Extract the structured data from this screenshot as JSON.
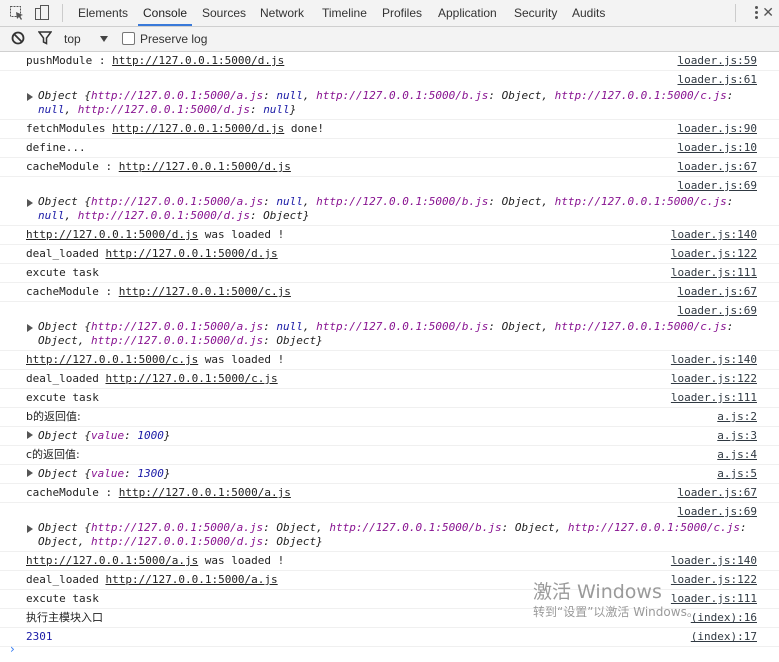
{
  "tabs": [
    "Elements",
    "Console",
    "Sources",
    "Network",
    "Timeline",
    "Profiles",
    "Application",
    "Security",
    "Audits"
  ],
  "active_tab": "Console",
  "filter": {
    "context": "top",
    "preserve_log_label": "Preserve log",
    "preserve_log_checked": false
  },
  "log": [
    {
      "text": "pushModule : ",
      "link": "http://127.0.0.1:5000/d.js",
      "src": "loader.js:59"
    },
    {
      "src": "loader.js:61",
      "obj": [
        {
          "t": "Object {"
        },
        {
          "k": "http://127.0.0.1:5000/a.js"
        },
        {
          "t": ": "
        },
        {
          "v": "null"
        },
        {
          "t": ", "
        },
        {
          "k": "http://127.0.0.1:5000/b.js"
        },
        {
          "t": ": Object, "
        },
        {
          "k": "http://127.0.0.1:5000/c.js"
        },
        {
          "t": ":"
        },
        {
          "br": true
        },
        {
          "v": "null"
        },
        {
          "t": ", "
        },
        {
          "k": "http://127.0.0.1:5000/d.js"
        },
        {
          "t": ": "
        },
        {
          "v": "null"
        },
        {
          "t": "}"
        }
      ]
    },
    {
      "text": "fetchModules ",
      "link": "http://127.0.0.1:5000/d.js",
      "after": " done!",
      "src": "loader.js:90"
    },
    {
      "text": "define...",
      "src": "loader.js:10"
    },
    {
      "text": "cacheModule : ",
      "link": "http://127.0.0.1:5000/d.js",
      "src": "loader.js:67"
    },
    {
      "src": "loader.js:69",
      "obj": [
        {
          "t": "Object {"
        },
        {
          "k": "http://127.0.0.1:5000/a.js"
        },
        {
          "t": ": "
        },
        {
          "v": "null"
        },
        {
          "t": ", "
        },
        {
          "k": "http://127.0.0.1:5000/b.js"
        },
        {
          "t": ": Object, "
        },
        {
          "k": "http://127.0.0.1:5000/c.js"
        },
        {
          "t": ":"
        },
        {
          "br": true
        },
        {
          "v": "null"
        },
        {
          "t": ", "
        },
        {
          "k": "http://127.0.0.1:5000/d.js"
        },
        {
          "t": ": Object}"
        }
      ]
    },
    {
      "link": "http://127.0.0.1:5000/d.js",
      "after": " was loaded !",
      "src": "loader.js:140"
    },
    {
      "text": "deal_loaded ",
      "link": "http://127.0.0.1:5000/d.js",
      "src": "loader.js:122"
    },
    {
      "text": "excute task",
      "src": "loader.js:111"
    },
    {
      "text": "cacheModule : ",
      "link": "http://127.0.0.1:5000/c.js",
      "src": "loader.js:67"
    },
    {
      "src": "loader.js:69",
      "obj": [
        {
          "t": "Object {"
        },
        {
          "k": "http://127.0.0.1:5000/a.js"
        },
        {
          "t": ": "
        },
        {
          "v": "null"
        },
        {
          "t": ", "
        },
        {
          "k": "http://127.0.0.1:5000/b.js"
        },
        {
          "t": ": Object, "
        },
        {
          "k": "http://127.0.0.1:5000/c.js"
        },
        {
          "t": ":"
        },
        {
          "br": true
        },
        {
          "t": "Object, "
        },
        {
          "k": "http://127.0.0.1:5000/d.js"
        },
        {
          "t": ": Object}"
        }
      ]
    },
    {
      "link": "http://127.0.0.1:5000/c.js",
      "after": " was loaded !",
      "src": "loader.js:140"
    },
    {
      "text": "deal_loaded ",
      "link": "http://127.0.0.1:5000/c.js",
      "src": "loader.js:122"
    },
    {
      "text": "excute task",
      "src": "loader.js:111"
    },
    {
      "text": "b的返回值:",
      "cjk": true,
      "src": "a.js:2"
    },
    {
      "src": "a.js:3",
      "inline_obj": [
        {
          "t": "Object {"
        },
        {
          "k": "value"
        },
        {
          "t": ": "
        },
        {
          "v": "1000"
        },
        {
          "t": "}"
        }
      ]
    },
    {
      "text": "c的返回值:",
      "cjk": true,
      "src": "a.js:4"
    },
    {
      "src": "a.js:5",
      "inline_obj": [
        {
          "t": "Object {"
        },
        {
          "k": "value"
        },
        {
          "t": ": "
        },
        {
          "v": "1300"
        },
        {
          "t": "}"
        }
      ]
    },
    {
      "text": "cacheModule : ",
      "link": "http://127.0.0.1:5000/a.js",
      "src": "loader.js:67"
    },
    {
      "src": "loader.js:69",
      "obj": [
        {
          "t": "Object {"
        },
        {
          "k": "http://127.0.0.1:5000/a.js"
        },
        {
          "t": ": Object, "
        },
        {
          "k": "http://127.0.0.1:5000/b.js"
        },
        {
          "t": ": Object, "
        },
        {
          "k": "http://127.0.0.1:5000/c.js"
        },
        {
          "t": ":"
        },
        {
          "br": true
        },
        {
          "t": "Object, "
        },
        {
          "k": "http://127.0.0.1:5000/d.js"
        },
        {
          "t": ": Object}"
        }
      ]
    },
    {
      "link": "http://127.0.0.1:5000/a.js",
      "after": " was loaded !",
      "src": "loader.js:140"
    },
    {
      "text": "deal_loaded ",
      "link": "http://127.0.0.1:5000/a.js",
      "src": "loader.js:122"
    },
    {
      "text": "excute task",
      "src": "loader.js:111"
    },
    {
      "text": "执行主模块入口",
      "cjk": true,
      "src": "(index):16"
    },
    {
      "text": "2301",
      "blue": true,
      "src": "(index):17"
    }
  ],
  "prompt": "›",
  "watermark": {
    "title": "激活 Windows",
    "subtitle": "转到“设置”以激活 Windows。"
  },
  "icons": [
    "inspect-element-icon",
    "device-mode-icon",
    "more-options-icon",
    "close-icon",
    "clear-console-icon",
    "filter-icon"
  ],
  "colors": {
    "tab_underline": "#3879d9",
    "object_key": "#881391",
    "literal_value": "#1a1aa6",
    "prompt": "#367cf1"
  }
}
